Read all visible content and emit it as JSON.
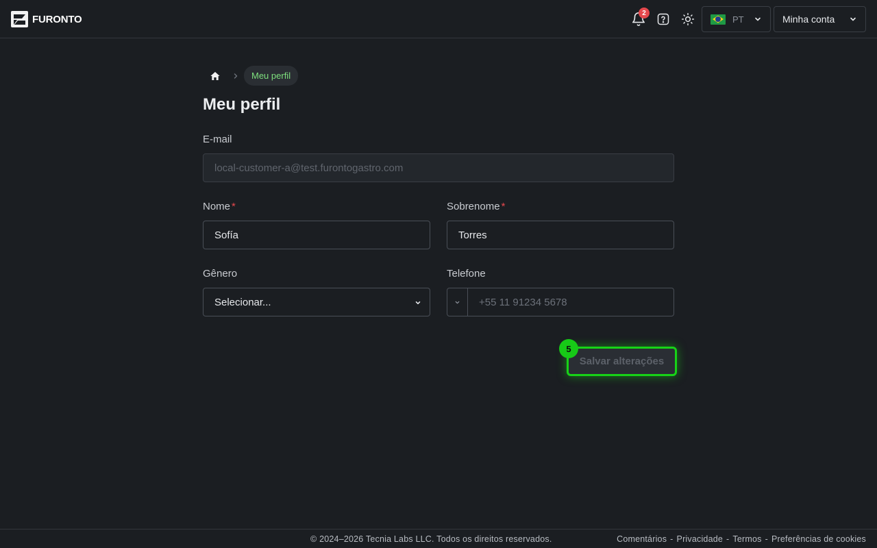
{
  "header": {
    "logo_text": "FURONTO",
    "notifications_count": "2",
    "language_code": "PT",
    "account_label": "Minha conta"
  },
  "breadcrumb": {
    "current": "Meu perfil"
  },
  "page": {
    "title": "Meu perfil"
  },
  "form": {
    "email": {
      "label": "E-mail",
      "value": "local-customer-a@test.furontogastro.com"
    },
    "first_name": {
      "label": "Nome",
      "required_mark": "*",
      "value": "Sofía"
    },
    "last_name": {
      "label": "Sobrenome",
      "required_mark": "*",
      "value": "Torres"
    },
    "gender": {
      "label": "Gênero",
      "value": "Selecionar..."
    },
    "phone": {
      "label": "Telefone",
      "placeholder": "+55 11 91234 5678"
    },
    "save_label": "Salvar alterações",
    "step_number": "5"
  },
  "footer": {
    "copyright": "© 2024–2026 Tecnia Labs LLC. Todos os direitos reservados.",
    "links": [
      "Comentários",
      "Privacidade",
      "Termos",
      "Preferências de cookies"
    ],
    "separator": "-"
  },
  "colors": {
    "background": "#1b1e22",
    "accent_green": "#17d317",
    "breadcrumb_green": "#7ee07e",
    "required_red": "#e5484d"
  }
}
